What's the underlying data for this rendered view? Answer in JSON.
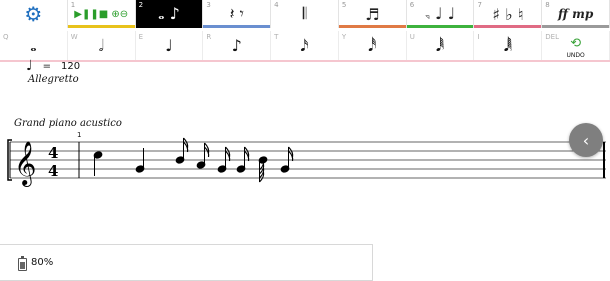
{
  "toolbar": {
    "tabs": [
      {
        "num": "",
        "glyph": "⚙",
        "bar": "#ffffff",
        "icon": "gear-icon"
      },
      {
        "num": "1",
        "glyph": "▶❚❚■ ⊕⊖",
        "bar": "#e8c21b",
        "icon": "playback-controls-icon"
      },
      {
        "num": "2",
        "glyph": "𝅝 ♪",
        "bar": "#000000",
        "icon": "notes-icon",
        "active": true
      },
      {
        "num": "3",
        "glyph": "𝄽 𝄾",
        "bar": "#6a8fd0",
        "icon": "rests-icon"
      },
      {
        "num": "4",
        "glyph": "𝄃",
        "bar": "#ffffff",
        "icon": "barline-icon"
      },
      {
        "num": "5",
        "glyph": "♬",
        "bar": "#e07a45",
        "icon": "beams-icon"
      },
      {
        "num": "6",
        "glyph": "𝅐 ♩ ♩",
        "bar": "#3db23d",
        "icon": "articulations-icon"
      },
      {
        "num": "7",
        "glyph": "♯ ♭ ♮",
        "bar": "#e06b84",
        "icon": "accidentals-icon"
      },
      {
        "num": "8",
        "glyph": "ff mp",
        "bar": "#9a9a9a",
        "icon": "dynamics-icon"
      }
    ],
    "keys": [
      {
        "letter": "Q",
        "glyph": "𝅝",
        "icon": "whole-note-icon"
      },
      {
        "letter": "W",
        "glyph": "𝅗𝅥",
        "icon": "half-note-icon"
      },
      {
        "letter": "E",
        "glyph": "♩",
        "icon": "quarter-note-icon"
      },
      {
        "letter": "R",
        "glyph": "♪",
        "icon": "eighth-note-icon"
      },
      {
        "letter": "T",
        "glyph": "𝅘𝅥𝅯",
        "icon": "sixteenth-note-icon"
      },
      {
        "letter": "Y",
        "glyph": "𝅘𝅥𝅰",
        "icon": "thirty-second-note-icon"
      },
      {
        "letter": "U",
        "glyph": "𝅘𝅥𝅱",
        "icon": "sixty-fourth-note-icon"
      },
      {
        "letter": "I",
        "glyph": "𝅘𝅥𝅲",
        "icon": "hundred-twenty-eighth-note-icon"
      },
      {
        "letter": "DEL",
        "glyph": "⟲",
        "icon": "undo-icon",
        "label": "UNDO"
      }
    ]
  },
  "score": {
    "tempo_value": "120",
    "tempo_equals": "=",
    "tempo_marking": "Allegretto",
    "instrument": "Grand piano acustico",
    "measure_number": "1",
    "time_signature_top": "4",
    "time_signature_bottom": "4"
  },
  "fab": {
    "glyph": "‹"
  },
  "status": {
    "battery": "80%",
    "battery_level": 0.8
  }
}
